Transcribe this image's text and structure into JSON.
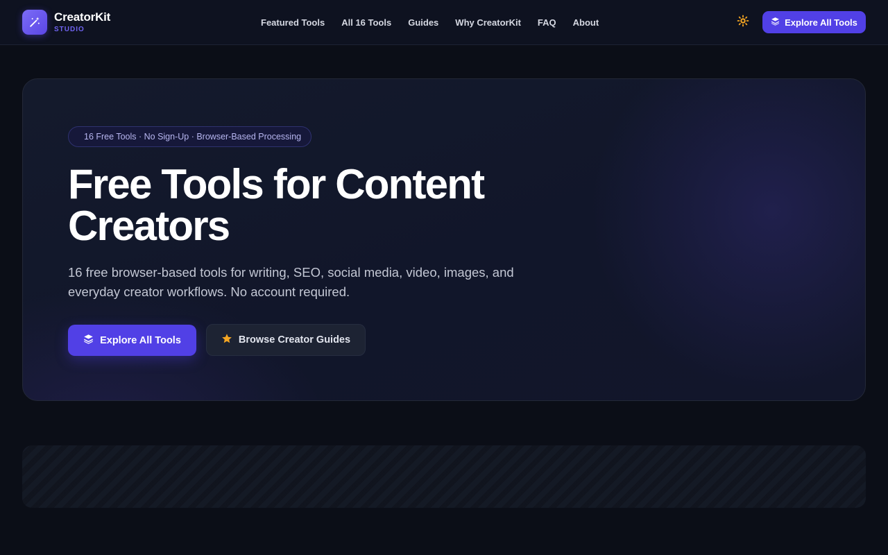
{
  "brand": {
    "name": "CreatorKit",
    "subtitle": "STUDIO",
    "accent_color": "#5140e6",
    "logo_icon": "magic-wand-icon"
  },
  "nav": {
    "items": [
      {
        "label": "Featured Tools"
      },
      {
        "label": "All 16 Tools"
      },
      {
        "label": "Guides"
      },
      {
        "label": "Why CreatorKit"
      },
      {
        "label": "FAQ"
      },
      {
        "label": "About"
      }
    ]
  },
  "header": {
    "theme_toggle_icon": "sun-icon",
    "cta_label": "Explore All Tools",
    "cta_icon": "layers-icon"
  },
  "hero": {
    "badge": "16 Free Tools · No Sign-Up · Browser-Based Processing",
    "title": "Free Tools for Content Creators",
    "description": "16 free browser-based tools for writing, SEO, social media, video, images, and everyday creator workflows. No account required.",
    "primary_button": {
      "label": "Explore All Tools",
      "icon": "layers-icon"
    },
    "secondary_button": {
      "label": "Browse Creator Guides",
      "icon": "star-icon",
      "icon_color": "#f5a623"
    }
  }
}
